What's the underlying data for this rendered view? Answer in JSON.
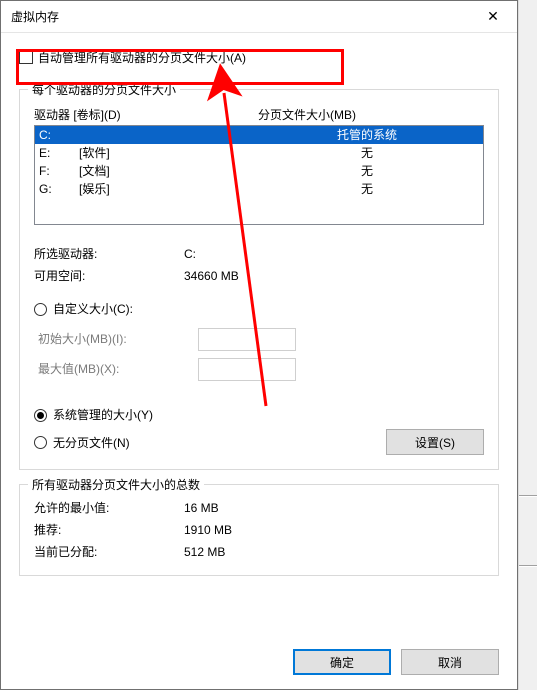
{
  "titlebar": {
    "title": "虚拟内存",
    "close_icon": "✕"
  },
  "auto_manage": {
    "label": "自动管理所有驱动器的分页文件大小(A)",
    "checked": false
  },
  "drives_group": {
    "legend": "每个驱动器的分页文件大小",
    "col_drive": "驱动器  [卷标](D)",
    "col_size": "分页文件大小(MB)",
    "rows": [
      {
        "letter": "C:",
        "label": "",
        "size": "托管的系统",
        "selected": true
      },
      {
        "letter": "E:",
        "label": "[软件]",
        "size": "无",
        "selected": false
      },
      {
        "letter": "F:",
        "label": "[文档]",
        "size": "无",
        "selected": false
      },
      {
        "letter": "G:",
        "label": "[娱乐]",
        "size": "无",
        "selected": false
      }
    ],
    "selected_drive_label": "所选驱动器:",
    "selected_drive_value": "C:",
    "free_space_label": "可用空间:",
    "free_space_value": "34660 MB",
    "radio_custom": "自定义大小(C):",
    "initial_label": "初始大小(MB)(I):",
    "max_label": "最大值(MB)(X):",
    "radio_system": "系统管理的大小(Y)",
    "radio_none": "无分页文件(N)",
    "set_button": "设置(S)"
  },
  "totals_group": {
    "legend": "所有驱动器分页文件大小的总数",
    "min_label": "允许的最小值:",
    "min_value": "16 MB",
    "rec_label": "推荐:",
    "rec_value": "1910 MB",
    "cur_label": "当前已分配:",
    "cur_value": "512 MB"
  },
  "actions": {
    "ok": "确定",
    "cancel": "取消"
  }
}
